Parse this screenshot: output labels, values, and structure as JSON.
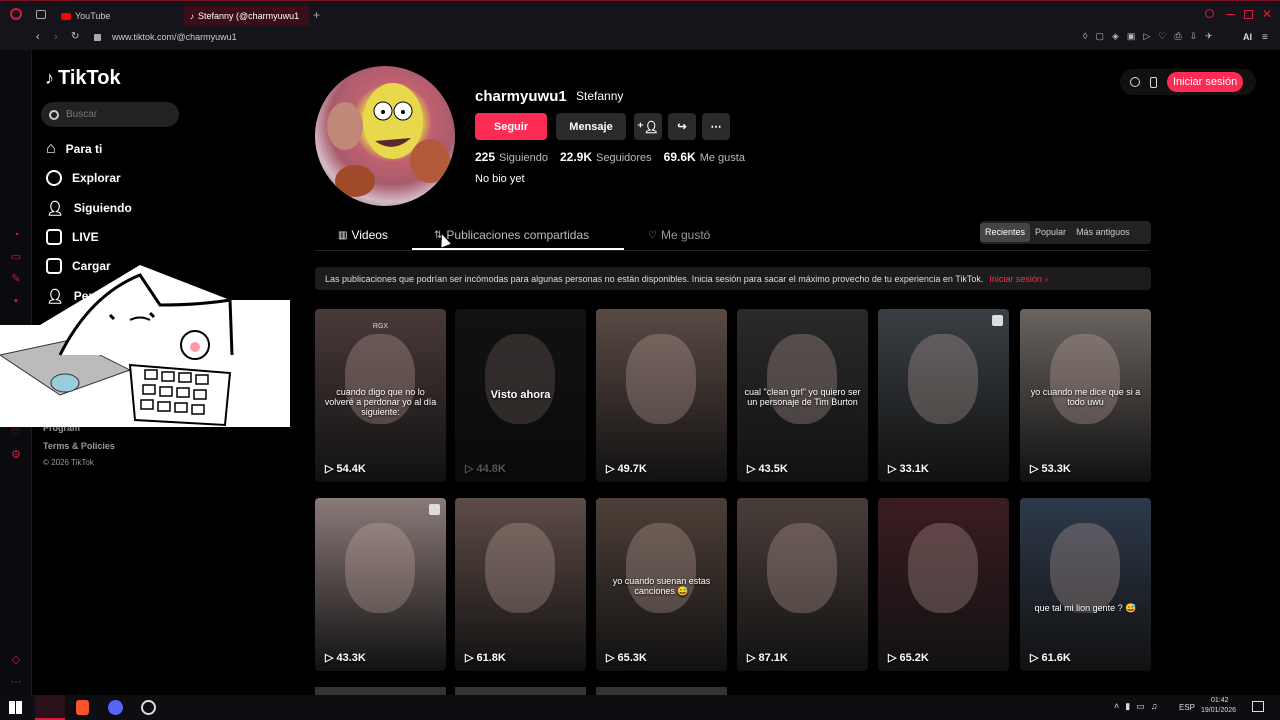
{
  "browser": {
    "tabs": [
      {
        "label": "YouTube"
      },
      {
        "label": "Stefanny (@charmyuwu1"
      }
    ],
    "url": "www.tiktok.com/@charmyuwu1"
  },
  "sidenav": {
    "logo": "TikTok",
    "search_placeholder": "Buscar",
    "items": [
      {
        "label": "Para ti"
      },
      {
        "label": "Explorar"
      },
      {
        "label": "Siguiendo"
      },
      {
        "label": "LIVE"
      },
      {
        "label": "Cargar"
      },
      {
        "label": "Per"
      }
    ],
    "footer": [
      "Program",
      "Terms & Policies",
      "© 2026 TikTok"
    ]
  },
  "header": {
    "login": "Iniciar sesión"
  },
  "profile": {
    "username": "charmyuwu1",
    "display_name": "Stefanny",
    "follow": "Seguir",
    "message": "Mensaje",
    "stats": [
      {
        "value": "225",
        "label": "Siguiendo"
      },
      {
        "value": "22.9K",
        "label": "Seguidores"
      },
      {
        "value": "69.6K",
        "label": "Me gusta"
      }
    ],
    "bio": "No bio yet"
  },
  "tabs": [
    {
      "label": "Videos"
    },
    {
      "label": "Publicaciones compartidas"
    },
    {
      "label": "Me gustó"
    }
  ],
  "sort": [
    {
      "label": "Recientes"
    },
    {
      "label": "Popular"
    },
    {
      "label": "Más antiguos"
    }
  ],
  "notice": {
    "text": "Las publicaciones que podrían ser incómodas para algunas personas no están disponibles. Inicia sesión para sacar el máximo provecho de tu experiencia en TikTok.",
    "link": "Iniciar sesión"
  },
  "videos": [
    {
      "views": "54.4K",
      "caption": "cuando digo que no lo volveré a perdonar yo al día siguiente:",
      "badge": "RGX",
      "bg": "#4a3a3a"
    },
    {
      "views": "44.8K",
      "caption": "Visto ahora",
      "bg": "#1c1c1c"
    },
    {
      "views": "49.7K",
      "caption": "",
      "bg": "#5a4a44"
    },
    {
      "views": "43.5K",
      "caption": "cual \"clean girl\" yo quiero ser un personaje de Tim Burton",
      "bg": "#2a2a2a"
    },
    {
      "views": "33.1K",
      "caption": "",
      "bg": "#3a3f44"
    },
    {
      "views": "53.3K",
      "caption": "yo cuando me dice que si a todo uwu",
      "bg": "#6a6460"
    },
    {
      "views": "43.3K",
      "caption": "",
      "bg": "#8a7a78"
    },
    {
      "views": "61.8K",
      "caption": "",
      "bg": "#5e4c46"
    },
    {
      "views": "65.3K",
      "caption": "yo cuando suenan estas canciones 😅",
      "bg": "#4e4038"
    },
    {
      "views": "87.1K",
      "caption": "",
      "bg": "#4a3e3a"
    },
    {
      "views": "65.2K",
      "caption": "",
      "bg": "#3a1c22"
    },
    {
      "views": "61.6K",
      "caption": "que tal mi lion gente ? 😅",
      "bg": "#2e3a4a"
    }
  ],
  "taskbar": {
    "lang": "ESP",
    "time": "01:42",
    "date": "19/01/2026"
  },
  "colors": {
    "accent": "#fe2c55"
  }
}
